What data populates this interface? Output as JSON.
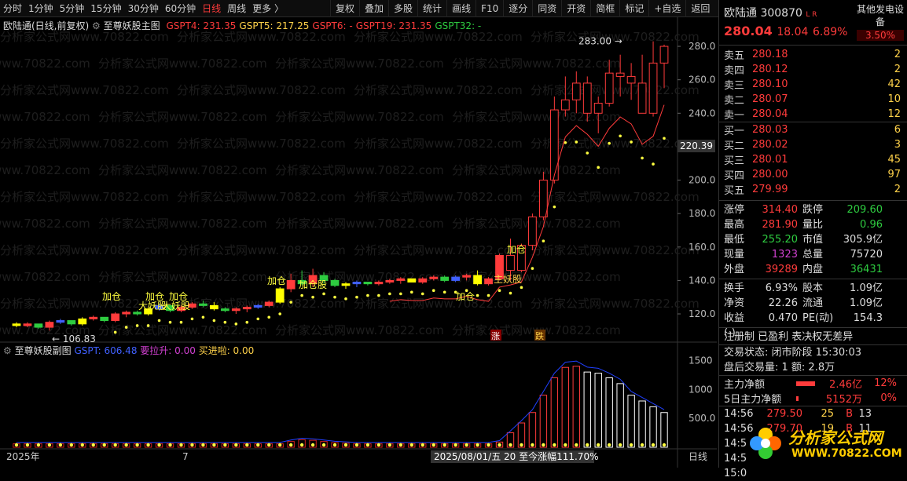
{
  "toolbar": {
    "periods": [
      "分时",
      "1分钟",
      "5分钟",
      "15分钟",
      "30分钟",
      "60分钟",
      "日线",
      "周线",
      "更多 〉"
    ],
    "active_period": "日线",
    "tools": [
      "复权",
      "叠加",
      "多股",
      "统计",
      "画线",
      "F10",
      "逐分",
      "同资",
      "开资",
      "简框",
      "标记",
      "+自选",
      "返回"
    ]
  },
  "main_chart": {
    "name": "欧陆通(日线,前复权)",
    "indicator": "至尊妖股主图",
    "gspt": [
      {
        "label": "GSPT4: 231.35",
        "color": "#ff3b3b"
      },
      {
        "label": "GSPT5: 217.25",
        "color": "#ffd24a"
      },
      {
        "label": "GSPT6: -",
        "color": "#ff3b3b"
      },
      {
        "label": "GSPT19: 231.35",
        "color": "#ff3b3b"
      },
      {
        "label": "GSPT32: -",
        "color": "#2ecc40"
      }
    ],
    "y_ticks": [
      "280.0",
      "260.0",
      "240.0",
      "220.0",
      "200.0",
      "180.0",
      "160.0",
      "140.0",
      "120.0"
    ],
    "cursor_price": "220.39",
    "high_label": "283.00",
    "low_label": "106.83",
    "annotations": [
      "加仓",
      "加仓",
      "加仓",
      "加仓",
      "大妖股",
      "大妖股",
      "加仓股",
      "加仓",
      "加仓",
      "主妖股"
    ],
    "signal_up": "涨",
    "signal_down": "跌"
  },
  "sub_chart": {
    "indicator": "至尊妖股副图",
    "gspt": "GSPT: 606.48",
    "yao": "要拉升: 0.00",
    "mai": "买进啦: 0.00",
    "y_ticks": [
      "1500",
      "1000",
      "500.0"
    ]
  },
  "bottom_axis": {
    "year": "2025年",
    "month": "7",
    "date_info": "2025/08/01/五  20  至今涨幅111.70%",
    "period": "日线"
  },
  "watermark": "分析家公式网www.70822.com",
  "quote": {
    "name": "欧陆通",
    "code": "300870",
    "badges": "L R",
    "other": "其他发电设备",
    "price": "280.04",
    "change": "18.04",
    "pct": "6.89%",
    "ratio": "3.50%",
    "sell": [
      {
        "label": "卖五",
        "price": "280.18",
        "vol": "2"
      },
      {
        "label": "卖四",
        "price": "280.12",
        "vol": "2"
      },
      {
        "label": "卖三",
        "price": "280.10",
        "vol": "42"
      },
      {
        "label": "卖二",
        "price": "280.07",
        "vol": "10"
      },
      {
        "label": "卖一",
        "price": "280.04",
        "vol": "12"
      }
    ],
    "buy": [
      {
        "label": "买一",
        "price": "280.03",
        "vol": "6"
      },
      {
        "label": "买二",
        "price": "280.02",
        "vol": "3"
      },
      {
        "label": "买三",
        "price": "280.01",
        "vol": "45"
      },
      {
        "label": "买四",
        "price": "280.00",
        "vol": "97"
      },
      {
        "label": "买五",
        "price": "279.99",
        "vol": "2"
      }
    ],
    "stats": [
      [
        "涨停",
        "314.40",
        "跌停",
        "209.60"
      ],
      [
        "最高",
        "281.90",
        "量比",
        "0.96"
      ],
      [
        "最低",
        "255.20",
        "市值",
        "305.9亿"
      ],
      [
        "现量",
        "1323",
        "总量",
        "75720"
      ],
      [
        "外盘",
        "39289",
        "内盘",
        "36431"
      ]
    ],
    "stats2": [
      [
        "换手",
        "6.93%",
        "股本",
        "1.09亿"
      ],
      [
        "净资",
        "22.26",
        "流通",
        "1.09亿"
      ],
      [
        "收益(-)",
        "0.470",
        "PE(动)",
        "154.3"
      ]
    ],
    "tags": "注册制  已盈利  表决权无差异",
    "trade_state": "交易状态: 闭市阶段 15:30:03",
    "after_hours": "盘后交易量: 1  额: 2.8万",
    "main_flow": {
      "label": "主力净额",
      "value": "2.46亿",
      "pct": "12%"
    },
    "flow5": {
      "label": "5日主力净额",
      "value": "5152万",
      "pct": "0%"
    },
    "ticks": [
      {
        "time": "14:56",
        "price": "279.50",
        "vol": "25",
        "dir": "B",
        "n": "13"
      },
      {
        "time": "14:56",
        "price": "279.70",
        "vol": "19",
        "dir": "B",
        "n": "11"
      },
      {
        "time": "14:5",
        "price": "",
        "vol": "",
        "dir": "",
        "n": ""
      },
      {
        "time": "14:5",
        "price": "",
        "vol": "",
        "dir": "",
        "n": ""
      },
      {
        "time": "15:0",
        "price": "",
        "vol": "",
        "dir": "",
        "n": ""
      }
    ],
    "logo_text": "分析家公式网",
    "logo_url": "WWW.70822.COM"
  },
  "chart_data": {
    "type": "candlestick",
    "series": [
      {
        "name": "K线",
        "ohlc": [
          [
            114,
            115,
            112,
            113
          ],
          [
            113,
            115,
            112,
            114
          ],
          [
            114,
            114,
            111,
            112
          ],
          [
            112,
            116,
            110,
            115
          ],
          [
            115,
            117,
            114,
            116
          ],
          [
            116,
            116,
            113,
            114
          ],
          [
            114,
            118,
            113,
            117
          ],
          [
            117,
            119,
            116,
            118
          ],
          [
            118,
            118,
            115,
            116
          ],
          [
            116,
            121,
            115,
            120
          ],
          [
            120,
            122,
            118,
            121
          ],
          [
            121,
            122,
            119,
            120
          ],
          [
            120,
            124,
            119,
            123
          ],
          [
            123,
            126,
            122,
            125
          ],
          [
            125,
            125,
            121,
            122
          ],
          [
            122,
            125,
            121,
            124
          ],
          [
            124,
            127,
            123,
            126
          ],
          [
            126,
            128,
            124,
            125
          ],
          [
            125,
            127,
            122,
            123
          ],
          [
            123,
            124,
            121,
            122
          ],
          [
            122,
            124,
            120,
            123
          ],
          [
            123,
            125,
            121,
            124
          ],
          [
            124,
            126,
            123,
            125
          ],
          [
            125,
            128,
            124,
            127
          ],
          [
            127,
            136,
            126,
            135
          ],
          [
            135,
            144,
            133,
            140
          ],
          [
            140,
            146,
            137,
            138
          ],
          [
            138,
            147,
            136,
            143
          ],
          [
            143,
            145,
            138,
            140
          ],
          [
            140,
            141,
            136,
            137
          ],
          [
            137,
            139,
            135,
            138
          ],
          [
            138,
            140,
            136,
            139
          ],
          [
            139,
            139,
            137,
            138
          ],
          [
            138,
            140,
            137,
            139
          ],
          [
            139,
            141,
            138,
            140
          ],
          [
            140,
            142,
            138,
            141
          ],
          [
            141,
            141,
            139,
            139
          ],
          [
            139,
            142,
            138,
            141
          ],
          [
            141,
            143,
            140,
            142
          ],
          [
            142,
            143,
            139,
            140
          ],
          [
            140,
            143,
            139,
            142
          ],
          [
            142,
            144,
            140,
            143
          ],
          [
            143,
            146,
            137,
            138
          ],
          [
            138,
            142,
            137,
            141
          ],
          [
            141,
            156,
            140,
            155
          ],
          [
            155,
            165,
            140,
            146
          ],
          [
            146,
            162,
            145,
            161
          ],
          [
            161,
            180,
            158,
            178
          ],
          [
            178,
            205,
            176,
            200
          ],
          [
            200,
            250,
            198,
            242
          ],
          [
            242,
            262,
            238,
            248
          ],
          [
            248,
            265,
            240,
            258
          ],
          [
            258,
            262,
            235,
            240
          ],
          [
            240,
            250,
            228,
            246
          ],
          [
            246,
            272,
            244,
            264
          ],
          [
            264,
            275,
            250,
            262
          ],
          [
            262,
            270,
            248,
            258
          ],
          [
            258,
            275,
            240,
            240
          ],
          [
            240,
            283,
            238,
            270
          ],
          [
            270,
            281,
            255,
            280
          ]
        ]
      }
    ],
    "ylim": [
      105,
      288
    ],
    "sub_values": [
      60,
      60,
      60,
      60,
      60,
      60,
      60,
      60,
      60,
      60,
      60,
      60,
      60,
      60,
      60,
      60,
      60,
      60,
      60,
      60,
      60,
      60,
      60,
      60,
      60,
      100,
      130,
      120,
      100,
      80,
      70,
      60,
      60,
      60,
      60,
      60,
      60,
      60,
      60,
      60,
      60,
      60,
      60,
      60,
      90,
      250,
      420,
      600,
      900,
      1200,
      1380,
      1400,
      1300,
      1280,
      1200,
      1100,
      900,
      800,
      700,
      600
    ]
  }
}
